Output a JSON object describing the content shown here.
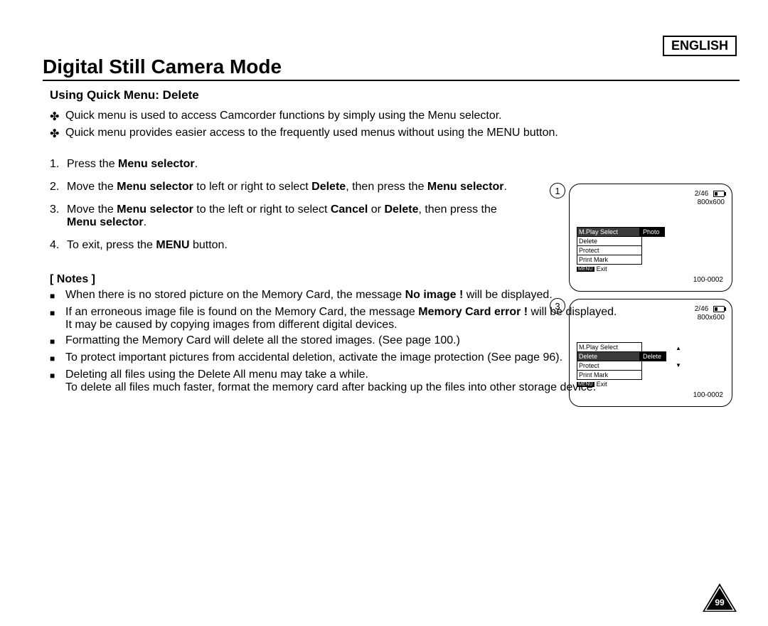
{
  "language_label": "ENGLISH",
  "page_title": "Digital Still Camera Mode",
  "section_heading": "Using Quick Menu: Delete",
  "intro": [
    "Quick menu is used to access Camcorder functions by simply using the Menu selector.",
    "Quick menu provides easier access to the frequently used menus without using the MENU button."
  ],
  "steps": [
    {
      "num": "1.",
      "pre": "Press the ",
      "bold1": "Menu selector",
      "post": "."
    },
    {
      "num": "2.",
      "text_html": "Move the <b>Menu selector</b> to left or right to select <b>Delete</b>, then press the <b>Menu selector</b>."
    },
    {
      "num": "3.",
      "text_html": "Move the <b>Menu selector</b> to the left or right to select <b>Cancel</b> or <b>Delete</b>, then press the <b>Menu selector</b>."
    },
    {
      "num": "4.",
      "text_html": "To exit, press the <b>MENU</b> button."
    }
  ],
  "notes_heading": "[ Notes ]",
  "notes": [
    "When there is no stored picture on the Memory Card, the message <b>No image !</b> will be displayed.",
    "If an erroneous image file is found on the Memory Card, the message <b>Memory Card error !</b> will be displayed.<br>It may be caused by copying images from different digital devices.",
    "Formatting the Memory Card will delete all the stored images. (See page 100.)",
    "To protect important pictures from accidental deletion, activate the image protection (See page 96).",
    "Deleting all files using the Delete All menu may take a while.<br>To delete all files much faster, format the memory card after backing up the files into other storage device."
  ],
  "screens": {
    "counter": "2/46",
    "resolution": "800x600",
    "filecode": "100-0002",
    "exit_label": "Exit",
    "menu_items": [
      "M.Play Select",
      "Delete",
      "Protect",
      "Print Mark"
    ],
    "screen1": {
      "circ": "1",
      "selected_index": 0,
      "tag": "Photo"
    },
    "screen3": {
      "circ": "3",
      "selected_index": 1,
      "tag": "Delete"
    }
  },
  "page_number": "99"
}
